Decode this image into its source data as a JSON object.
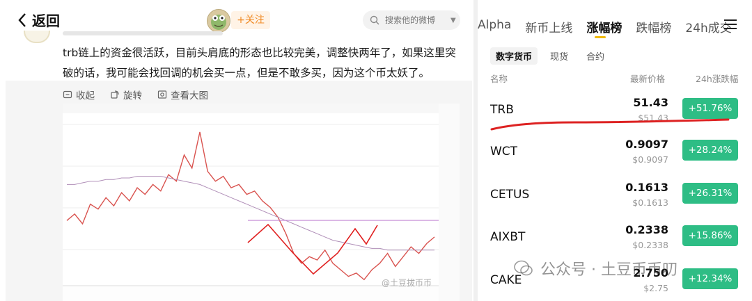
{
  "header": {
    "back_label": "返回",
    "follow_label": "+关注",
    "search_placeholder": "搜索他的微博"
  },
  "post": {
    "text": "trb链上的资金很活跃，目前头肩底的形态也比较完美，调整快两年了，如果这里突破的话，我可能会找回调的机会买一点，但是不敢多买，因为这个币太妖了。"
  },
  "image_toolbar": {
    "collapse_label": "收起",
    "rotate_label": "旋转",
    "view_large_label": "查看大图"
  },
  "watermark": "@土豆拔币币",
  "market": {
    "tabs": [
      "Alpha",
      "新币上线",
      "涨幅榜",
      "跌幅榜",
      "24h成交"
    ],
    "active_tab": 2,
    "subtabs": [
      "数字货币",
      "现货",
      "合约"
    ],
    "columns": {
      "name": "名称",
      "price": "最新价格",
      "change": "24h涨跌幅"
    },
    "rows": [
      {
        "symbol": "TRB",
        "price": "51.43",
        "price_sub": "$51.43",
        "change": "+51.76%"
      },
      {
        "symbol": "WCT",
        "price": "0.9097",
        "price_sub": "$0.9097",
        "change": "+28.24%"
      },
      {
        "symbol": "CETUS",
        "price": "0.1613",
        "price_sub": "$0.1613",
        "change": "+26.31%"
      },
      {
        "symbol": "AIXBT",
        "price": "0.2338",
        "price_sub": "$0.2338",
        "change": "+15.86%"
      },
      {
        "symbol": "CAKE",
        "price": "2.750",
        "price_sub": "$2.75",
        "change": "+12.34%"
      }
    ],
    "accent_color": "#f0b90b",
    "up_color": "#2ebd85"
  },
  "wechat_watermark": "公众号 · 土豆币币叨",
  "chart_data": {
    "type": "line",
    "series": [
      {
        "values": [
          38,
          42,
          36,
          48,
          45,
          52,
          47,
          55,
          50,
          58,
          54,
          60,
          56,
          66,
          62,
          78,
          70,
          92,
          68,
          62,
          65,
          58,
          60,
          54,
          56,
          50,
          46,
          40,
          30,
          18,
          12,
          16,
          14,
          20,
          12,
          8,
          4,
          6,
          2,
          8,
          12,
          18,
          10,
          16,
          22,
          18,
          24,
          28
        ]
      },
      {
        "values": [
          60,
          60,
          61,
          62,
          62,
          63,
          63,
          64,
          64,
          65,
          65,
          65,
          65,
          64,
          63,
          62,
          61,
          60,
          58,
          56,
          54,
          52,
          50,
          48,
          46,
          44,
          42,
          40,
          38,
          36,
          34,
          32,
          30,
          28,
          26,
          25,
          24,
          23,
          22,
          21,
          21,
          20,
          20,
          20,
          20,
          20,
          20,
          20
        ]
      }
    ]
  }
}
